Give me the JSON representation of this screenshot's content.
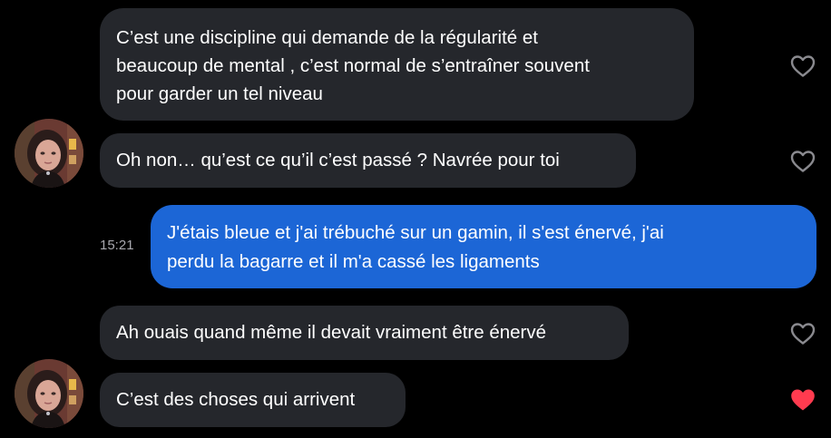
{
  "messages": [
    {
      "direction": "received",
      "lines": [
        "C’est une discipline qui demande de la régularité et",
        "beaucoup de mental , c’est normal de s’entraîner souvent",
        "pour garder un tel niveau"
      ],
      "liked": false
    },
    {
      "direction": "received",
      "lines": [
        "Oh non… qu’est ce qu’il c’est passé ? Navrée pour toi"
      ],
      "liked": false
    },
    {
      "direction": "sent",
      "timestamp": "15:21",
      "lines": [
        "J'étais bleue et j'ai trébuché sur un gamin, il s'est énervé, j'ai",
        "perdu la bagarre et il m'a cassé les ligaments"
      ]
    },
    {
      "direction": "received",
      "lines": [
        "Ah ouais quand même il devait vraiment être énervé"
      ],
      "liked": false
    },
    {
      "direction": "received",
      "lines": [
        "C’est des choses qui arrivent"
      ],
      "liked": true
    }
  ],
  "icons": {
    "heart_outline": "heart-outline-icon",
    "heart_filled": "heart-filled-icon"
  },
  "colors": {
    "background": "#000000",
    "received_bubble": "#25272c",
    "sent_bubble": "#1c66d6",
    "heart_outline": "#8a8a8f",
    "heart_liked": "#ff3b4f",
    "timestamp": "#a8a8ae"
  }
}
